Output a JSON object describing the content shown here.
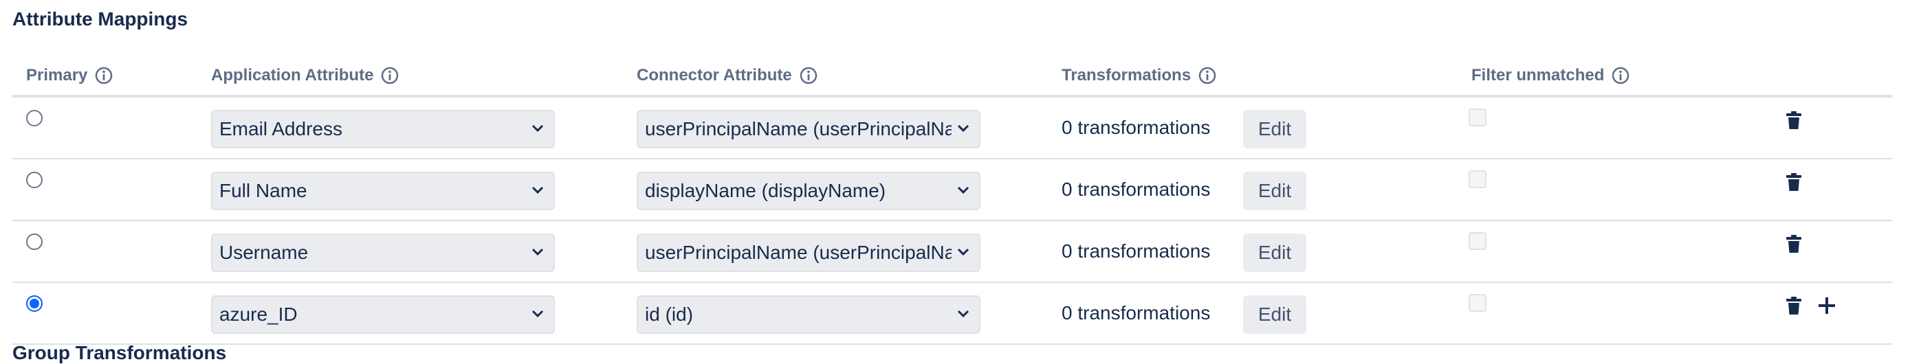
{
  "section": {
    "title": "Attribute Mappings"
  },
  "columns": {
    "primary": "Primary",
    "application_attribute": "Application Attribute",
    "connector_attribute": "Connector Attribute",
    "transformations": "Transformations",
    "filter_unmatched": "Filter unmatched"
  },
  "rows": [
    {
      "primary": false,
      "app_attr": "Email Address",
      "connector_attr": "userPrincipalName (userPrincipalName)",
      "transformations": "0 transformations",
      "edit_label": "Edit",
      "filter_unmatched": false
    },
    {
      "primary": false,
      "app_attr": "Full Name",
      "connector_attr": "displayName (displayName)",
      "transformations": "0 transformations",
      "edit_label": "Edit",
      "filter_unmatched": false
    },
    {
      "primary": false,
      "app_attr": "Username",
      "connector_attr": "userPrincipalName (userPrincipalName)",
      "transformations": "0 transformations",
      "edit_label": "Edit",
      "filter_unmatched": false
    },
    {
      "primary": true,
      "app_attr": "azure_ID",
      "connector_attr": "id (id)",
      "transformations": "0 transformations",
      "edit_label": "Edit",
      "filter_unmatched": false
    }
  ],
  "icons": {
    "info": "info-icon",
    "chevron": "chevron-down-icon",
    "delete": "trash-icon",
    "add": "plus-icon"
  },
  "next_section": {
    "title": "Group Transformations"
  },
  "colors": {
    "accent": "#0b63ff",
    "text": "#172b4d",
    "muted": "#5e6c84",
    "field_bg": "#ebecf0",
    "divider": "#dfe1e6"
  }
}
